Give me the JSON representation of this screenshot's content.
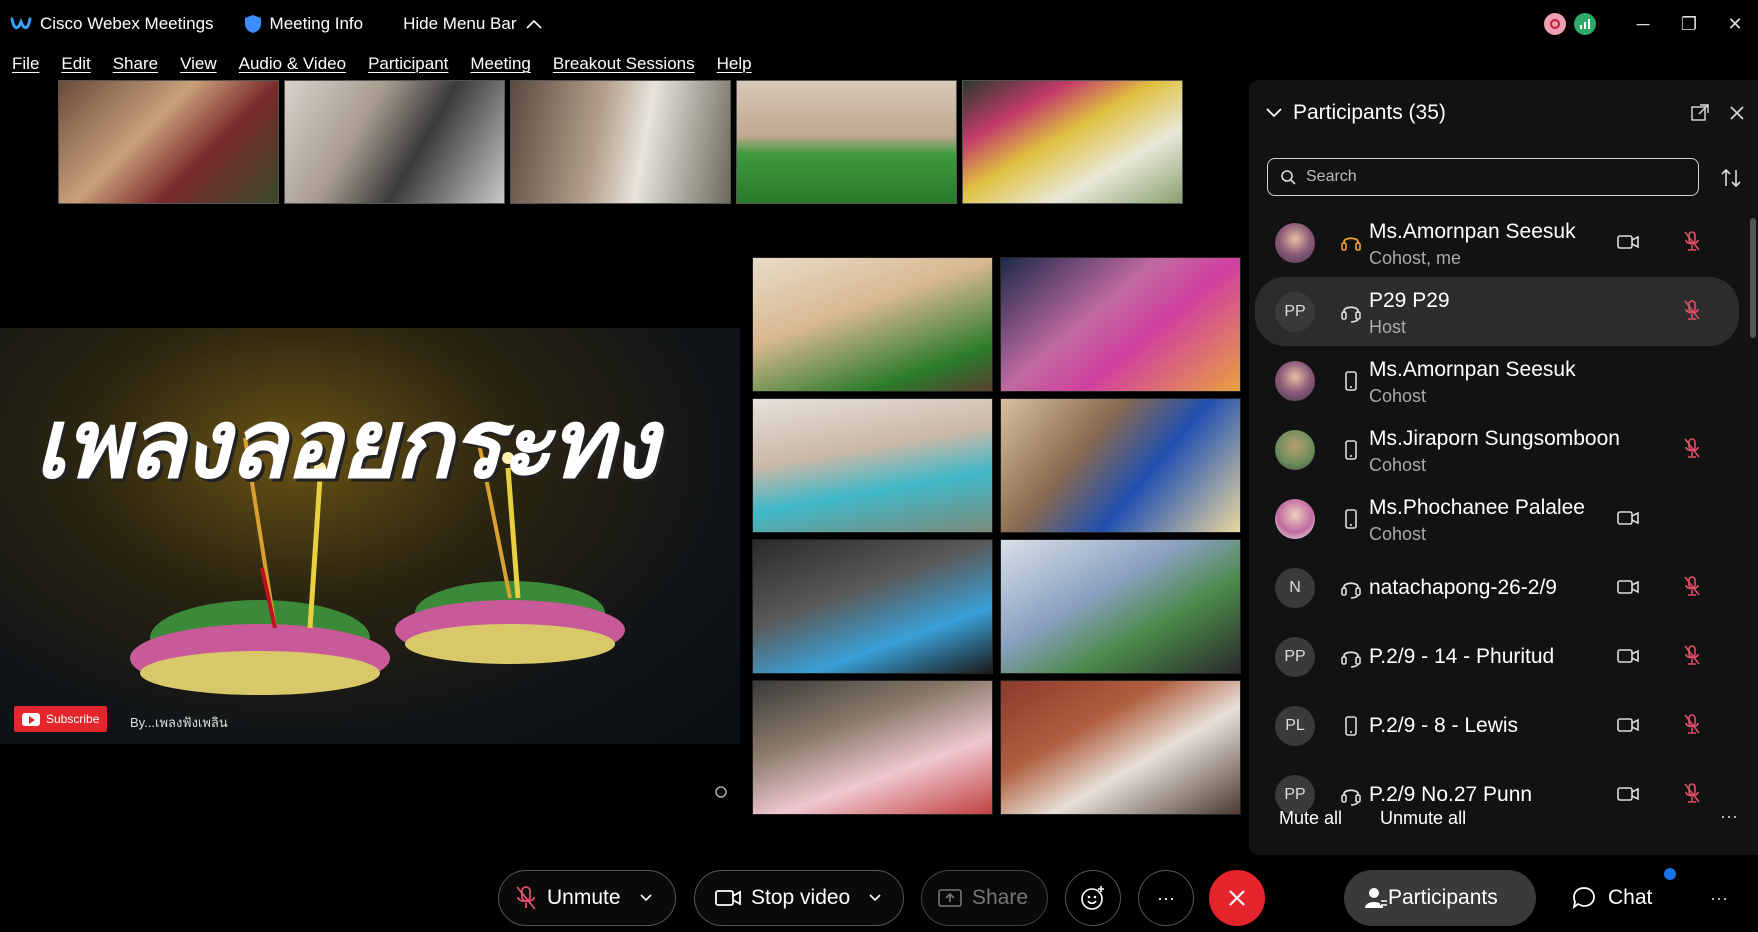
{
  "titlebar": {
    "app_title": "Cisco Webex Meetings",
    "meeting_info": "Meeting Info",
    "hide_menu": "Hide Menu Bar",
    "window_buttons": [
      "─",
      "❐",
      "✕"
    ]
  },
  "menu": [
    "File",
    "Edit",
    "Share",
    "View",
    "Audio & Video",
    "Participant",
    "Meeting",
    "Breakout Sessions",
    "Help"
  ],
  "share": {
    "title": "เพลงลอยกระทง",
    "subscribe": "Subscribe",
    "byline": "By...เพลงฟังเพลิน"
  },
  "panel": {
    "title": "Participants (35)",
    "search_placeholder": "Search",
    "participants": [
      {
        "name": "Ms.Amornpan Seesuk",
        "role": "Cohost, me",
        "avatar": "",
        "device": "headset-icon",
        "video": true,
        "muted": true,
        "active": false
      },
      {
        "name": "P29 P29",
        "role": "Host",
        "avatar": "PP",
        "device": "headset-icon",
        "video": false,
        "muted": true,
        "active": true
      },
      {
        "name": "Ms.Amornpan Seesuk",
        "role": "Cohost",
        "avatar": "",
        "device": "phone-icon",
        "video": false,
        "muted": false,
        "active": false
      },
      {
        "name": "Ms.Jiraporn Sungsomboon",
        "role": "Cohost",
        "avatar": "",
        "device": "phone-icon",
        "video": false,
        "muted": true,
        "active": false
      },
      {
        "name": "Ms.Phochanee Palalee",
        "role": "Cohost",
        "avatar": "",
        "device": "phone-icon",
        "video": true,
        "muted": false,
        "active": false
      },
      {
        "name": "natachapong-26-2/9",
        "role": "",
        "avatar": "N",
        "device": "headset-icon",
        "video": true,
        "muted": true,
        "active": false
      },
      {
        "name": "P.2/9 - 14 - Phuritud",
        "role": "",
        "avatar": "PP",
        "device": "headset-icon",
        "video": true,
        "muted": true,
        "active": false
      },
      {
        "name": "P.2/9 - 8 - Lewis",
        "role": "",
        "avatar": "PL",
        "device": "phone-icon",
        "video": true,
        "muted": true,
        "active": false
      },
      {
        "name": "P.2/9 No.27 Punn",
        "role": "",
        "avatar": "PP",
        "device": "headset-icon",
        "video": true,
        "muted": true,
        "active": false
      }
    ],
    "mute_all": "Mute all",
    "unmute_all": "Unmute all",
    "more": "···"
  },
  "controls": {
    "unmute": "Unmute",
    "stop_video": "Stop video",
    "share": "Share",
    "more": "···",
    "participants": "Participants",
    "chat": "Chat",
    "overflow": "···"
  },
  "colors": {
    "leave": "#e5242c",
    "accent": "#1a73e8",
    "muted_mic": "#e0506a"
  }
}
